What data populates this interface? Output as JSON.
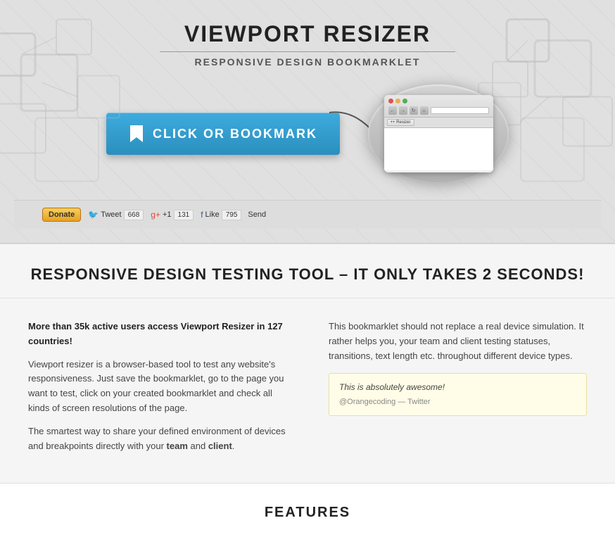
{
  "header": {
    "title": "VIEWPORT RESIZER",
    "subtitle": "RESPONSIVE DESIGN BOOKMARKLET",
    "cta_button_label": "CLICK OR BOOKMARK"
  },
  "social": {
    "donate_label": "Donate",
    "twitter_label": "Tweet",
    "twitter_count": "668",
    "gplus_label": "+1",
    "gplus_count": "131",
    "facebook_label": "Like",
    "facebook_count": "795",
    "send_label": "Send"
  },
  "browser_mockup": {
    "toolbar_label": "++ Resizer"
  },
  "main": {
    "headline": "RESPONSIVE DESIGN TESTING TOOL – IT ONLY TAKES 2 SECONDS!",
    "col_left": {
      "intro": "More than 35k active users access Viewport Resizer in 127 countries!",
      "p1": "Viewport resizer is a browser-based tool to test any website's responsiveness. Just save the bookmarklet, go to the page you want to test, click on your created bookmarklet and check all kinds of screen resolutions of the page.",
      "p2_start": "The smartest way to share your defined environment of devices and breakpoints directly with your ",
      "p2_team": "team",
      "p2_mid": " and ",
      "p2_client": "client",
      "p2_end": "."
    },
    "col_right": {
      "p1": "This bookmarklet should not replace a real device simulation. It rather helps you, your team and client testing statuses, transitions, text length etc. throughout different device types.",
      "tweet_text": "This is absolutely awesome!",
      "tweet_author": "@Orangecoding — Twitter"
    }
  },
  "features": {
    "title": "FEATURES"
  }
}
